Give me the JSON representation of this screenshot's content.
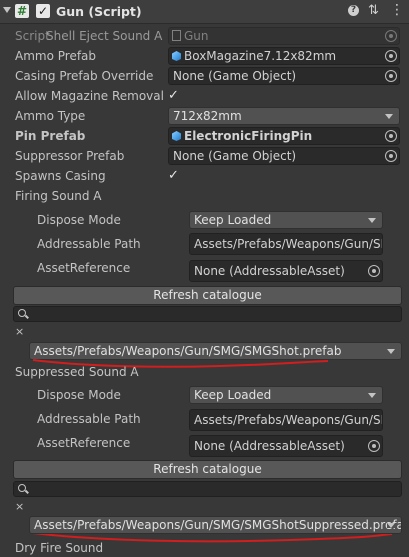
{
  "header": {
    "component_title": "Gun (Script)",
    "enabled": true
  },
  "rows": {
    "script_label": "Script",
    "script_value": "Gun",
    "overlap_label": "Shell Eject Sound A",
    "ammo_prefab_label": "Ammo Prefab",
    "ammo_prefab_value": "BoxMagazine7.12x82mm",
    "casing_label": "Casing Prefab Override",
    "casing_value": "None (Game Object)",
    "allow_mag_label": "Allow Magazine Removal",
    "allow_mag_checked": true,
    "ammo_type_label": "Ammo Type",
    "ammo_type_value": "712x82mm",
    "pin_label": "Pin Prefab",
    "pin_value": "ElectronicFiringPin",
    "suppressor_label": "Suppressor Prefab",
    "suppressor_value": "None (Game Object)",
    "spawns_casing_label": "Spawns Casing",
    "spawns_casing_checked": true
  },
  "firing_sound": {
    "section_label": "Firing Sound A",
    "dispose_label": "Dispose Mode",
    "dispose_value": "Keep Loaded",
    "addr_label": "Addressable Path",
    "addr_value": "Assets/Prefabs/Weapons/Gun/SM",
    "assetref_label": "AssetReference",
    "assetref_value": "None (AddressableAsset)",
    "refresh_label": "Refresh catalogue",
    "close_glyph": "×",
    "selected_path": "Assets/Prefabs/Weapons/Gun/SMG/SMGShot.prefab"
  },
  "suppressed_sound": {
    "section_label": "Suppressed Sound A",
    "dispose_label": "Dispose Mode",
    "dispose_value": "Keep Loaded",
    "addr_label": "Addressable Path",
    "addr_value": "Assets/Prefabs/Weapons/Gun/SM",
    "assetref_label": "AssetReference",
    "assetref_value": "None (AddressableAsset)",
    "refresh_label": "Refresh catalogue",
    "close_glyph": "×",
    "selected_path": "Assets/Prefabs/Weapons/Gun/SMG/SMGShotSuppressed.prefab"
  },
  "footer": {
    "next_label": "Dry Fire Sound"
  },
  "icons": {
    "script_icon": "hash-icon",
    "help_icon": "help-icon",
    "presets_icon": "sliders-icon",
    "menu_icon": "kebab-menu-icon",
    "object_picker_icon": "object-picker-icon",
    "prefab_icon": "prefab-cube-icon",
    "asset_picker_icon": "asset-picker-icon",
    "search_icon": "search-icon"
  },
  "colors": {
    "background": "#383838",
    "header_background": "#3e3e3e",
    "field_background": "#2a2a2a",
    "button_background": "#585858",
    "annotation_red": "#d11e1e"
  }
}
